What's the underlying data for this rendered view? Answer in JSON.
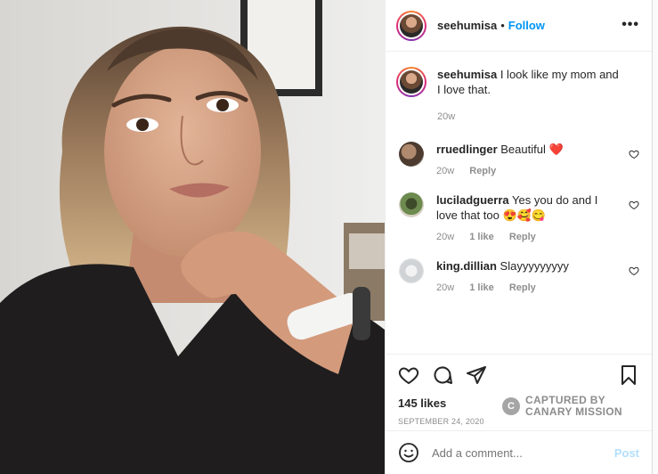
{
  "post": {
    "username": "seehumisa",
    "follow_label": "Follow",
    "separator": "•",
    "more_label": "•••"
  },
  "caption": {
    "username": "seehumisa",
    "text": "I look like my mom and I love that.",
    "time": "20w"
  },
  "comments": [
    {
      "username": "rruedlinger",
      "text": "Beautiful ❤️",
      "time": "20w",
      "likes": "",
      "reply": "Reply"
    },
    {
      "username": "luciladguerra",
      "text": "Yes you do and I love that too 😍🥰😋",
      "time": "20w",
      "likes": "1 like",
      "reply": "Reply"
    },
    {
      "username": "king.dillian",
      "text": "Slayyyyyyyyy",
      "time": "20w",
      "likes": "1 like",
      "reply": "Reply"
    }
  ],
  "actions": {
    "likes": "145 likes",
    "date": "SEPTEMBER 24, 2020"
  },
  "add_comment": {
    "placeholder": "Add a comment...",
    "post_label": "Post"
  },
  "watermark": {
    "line1": "CAPTURED BY",
    "line2": "CANARY MISSION",
    "logo": "C"
  },
  "colors": {
    "accent": "#0095f6",
    "text": "#262626",
    "muted": "#8e8e8e",
    "post_disabled": "#b2dffc"
  },
  "icons": [
    "more-icon",
    "heart-icon",
    "comment-icon",
    "share-icon",
    "save-icon",
    "smile-icon",
    "small-heart-icon"
  ]
}
